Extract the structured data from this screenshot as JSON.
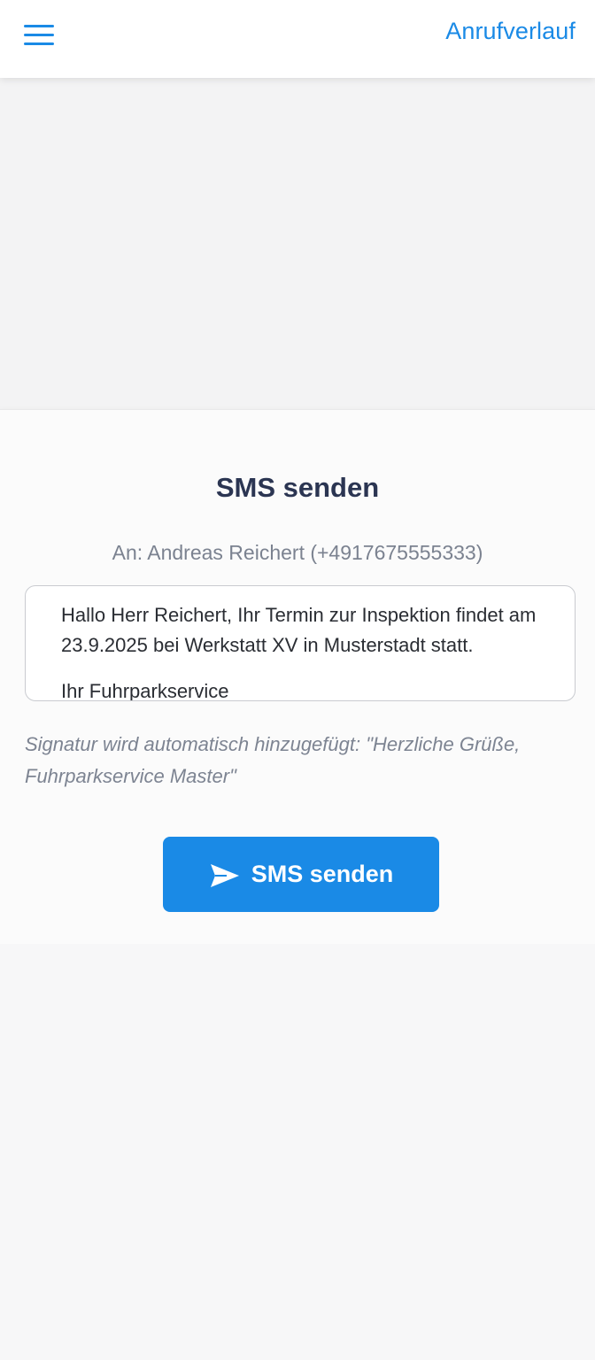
{
  "header": {
    "history_label": "Anrufverlauf",
    "menu_icon": "hamburger-menu-icon"
  },
  "sms_form": {
    "title": "SMS senden",
    "recipient": "An: Andreas Reichert (+4917675555333)",
    "message_lines": [
      "Hallo Herr Reichert, Ihr Termin zur Inspektion findet am 23.9.2025 bei Werkstatt XV in Musterstadt statt.",
      "Ihr Fuhrparkservice"
    ],
    "signature_note": "Signatur wird automatisch hinzugefügt: \"Herzliche Grüße, Fuhrparkservice Master\"",
    "send_label": "SMS senden",
    "send_icon": "send-paper-plane-icon"
  },
  "colors": {
    "accent": "#1a8ae6",
    "title": "#2b3552",
    "muted": "#7b8290"
  }
}
